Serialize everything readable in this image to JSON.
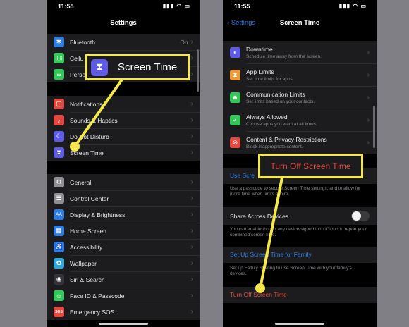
{
  "left_phone": {
    "status_time": "11:55",
    "nav_title": "Settings",
    "group1": [
      {
        "label": "Bluetooth",
        "value": "On",
        "color": "#2f7de1",
        "icon": "bluetooth-icon",
        "glyph": "✱"
      },
      {
        "label": "Cellu",
        "value": "",
        "color": "#34c759",
        "icon": "cellular-icon",
        "glyph": "((·))"
      },
      {
        "label": "Perso",
        "value": "",
        "color": "#34c759",
        "icon": "hotspot-icon",
        "glyph": "∞"
      }
    ],
    "group2": [
      {
        "label": "Notifications",
        "color": "#e5483f",
        "icon": "notifications-icon",
        "glyph": "▢"
      },
      {
        "label": "Sounds & Haptics",
        "color": "#e5483f",
        "icon": "sounds-icon",
        "glyph": "♪"
      },
      {
        "label": "Do Not Disturb",
        "color": "#5e5ce6",
        "icon": "moon-icon",
        "glyph": "☾"
      },
      {
        "label": "Screen Time",
        "color": "#5e5ce6",
        "icon": "hourglass-icon",
        "glyph": "⧗"
      }
    ],
    "group3": [
      {
        "label": "General",
        "color": "#8e8e93",
        "icon": "gear-icon",
        "glyph": "⚙"
      },
      {
        "label": "Control Center",
        "color": "#8e8e93",
        "icon": "control-center-icon",
        "glyph": "☰"
      },
      {
        "label": "Display & Brightness",
        "color": "#2f7de1",
        "icon": "display-icon",
        "glyph": "AA"
      },
      {
        "label": "Home Screen",
        "color": "#2f7de1",
        "icon": "home-screen-icon",
        "glyph": "▦"
      },
      {
        "label": "Accessibility",
        "color": "#2f7de1",
        "icon": "accessibility-icon",
        "glyph": "♿"
      },
      {
        "label": "Wallpaper",
        "color": "#30a7d9",
        "icon": "wallpaper-icon",
        "glyph": "✿"
      },
      {
        "label": "Siri & Search",
        "color": "#333338",
        "icon": "siri-icon",
        "glyph": "◉"
      },
      {
        "label": "Face ID & Passcode",
        "color": "#34c759",
        "icon": "face-id-icon",
        "glyph": "☺"
      },
      {
        "label": "Emergency SOS",
        "color": "#e5483f",
        "icon": "sos-icon",
        "glyph": "SOS"
      }
    ],
    "callout_label": "Screen Time"
  },
  "right_phone": {
    "status_time": "11:55",
    "back_label": "Settings",
    "nav_title": "Screen Time",
    "items": [
      {
        "title": "Downtime",
        "subtitle": "Schedule time away from the screen.",
        "color": "#5e5ce6",
        "icon": "downtime-icon",
        "glyph": "◐"
      },
      {
        "title": "App Limits",
        "subtitle": "Set time limits for apps.",
        "color": "#f09a37",
        "icon": "hourglass-icon",
        "glyph": "⧗"
      },
      {
        "title": "Communication Limits",
        "subtitle": "Set limits based on your contacts.",
        "color": "#34c759",
        "icon": "contacts-icon",
        "glyph": "☻"
      },
      {
        "title": "Always Allowed",
        "subtitle": "Choose apps you want at all times.",
        "color": "#34c759",
        "icon": "checkmark-icon",
        "glyph": "✓"
      },
      {
        "title": "Content & Privacy Restrictions",
        "subtitle": "Block inappropriate content.",
        "color": "#e5483f",
        "icon": "restriction-icon",
        "glyph": "⊘"
      }
    ],
    "passcode_link": "Use Scre",
    "passcode_footer": "Use a passcode to secure Screen Time settings, and to allow for more time when limits expire.",
    "share_label": "Share Across Devices",
    "share_footer": "You can enable this on any device signed in to iCloud to report your combined screen time.",
    "family_link": "Set Up Screen Time for Family",
    "family_footer": "Set up Family Sharing to use Screen Time with your family's devices.",
    "turn_off_label": "Turn Off Screen Time",
    "callout_label": "Turn Off Screen Time"
  },
  "colors": {
    "highlight": "#f5e84a",
    "link": "#2f7de1",
    "danger": "#e5483f"
  }
}
